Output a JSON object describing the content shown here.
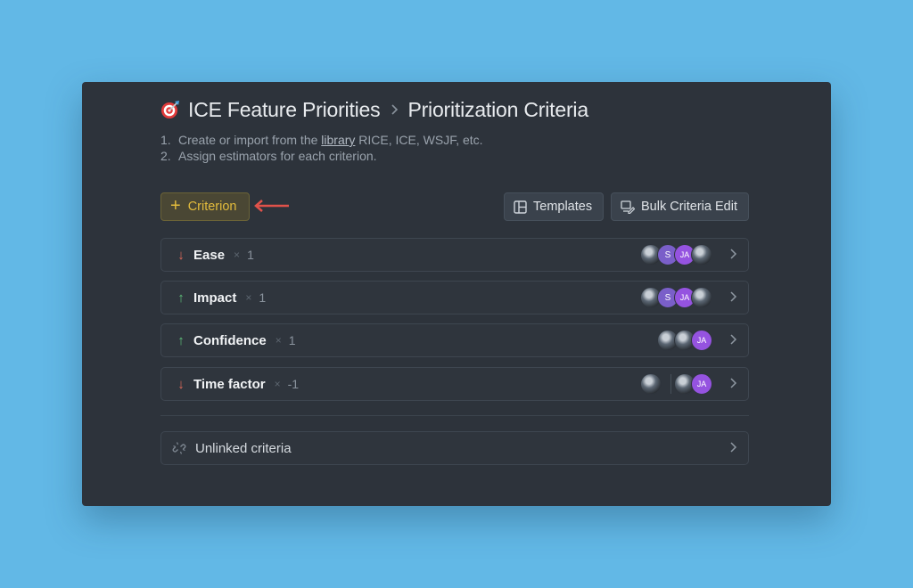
{
  "breadcrumb": {
    "icon": "target-dart-icon",
    "project": "ICE Feature Priorities",
    "separator_icon": "chevron-right-icon",
    "current": "Prioritization Criteria"
  },
  "steps": [
    {
      "num": "1.",
      "before": "Create or import from the ",
      "link": "library",
      "after": " RICE, ICE, WSJF, etc."
    },
    {
      "num": "2.",
      "text": "Assign estimators for each criterion."
    }
  ],
  "toolbar": {
    "add_label": "Criterion",
    "templates_label": "Templates",
    "bulk_label": "Bulk Criteria Edit"
  },
  "criteria": [
    {
      "direction": "down",
      "arrow": "↓",
      "name": "Ease",
      "times": "×",
      "weight": "1",
      "avatars": [
        "photo",
        "S",
        "JA",
        "photo"
      ]
    },
    {
      "direction": "up",
      "arrow": "↑",
      "name": "Impact",
      "times": "×",
      "weight": "1",
      "avatars": [
        "photo",
        "S",
        "JA",
        "photo"
      ]
    },
    {
      "direction": "up",
      "arrow": "↑",
      "name": "Confidence",
      "times": "×",
      "weight": "1",
      "avatars": [
        "photo",
        "photo",
        "JA"
      ]
    },
    {
      "direction": "down",
      "arrow": "↓",
      "name": "Time factor",
      "times": "×",
      "weight": "-1",
      "avatars_left": [
        "photo"
      ],
      "avatars": [
        "photo",
        "JA"
      ]
    }
  ],
  "unlinked": {
    "icon": "unlink-icon",
    "label": "Unlinked criteria"
  },
  "colors": {
    "accent": "#e2bb3c",
    "down": "#e06a5a",
    "up": "#5fbf7a",
    "avatar_ja": "#9553e0",
    "hint_arrow": "#e0524a"
  }
}
